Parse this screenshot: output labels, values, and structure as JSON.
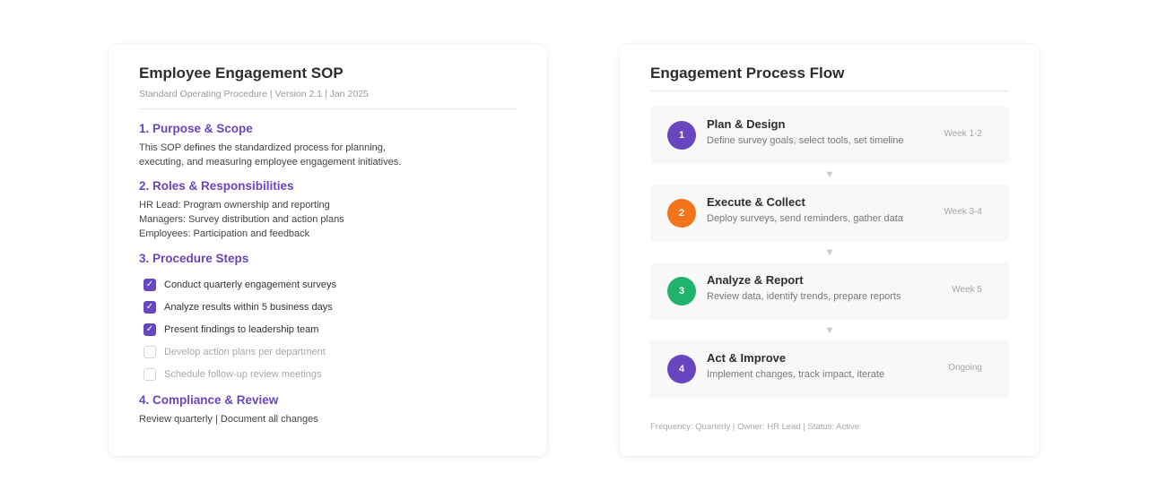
{
  "sop": {
    "title": "Employee Engagement SOP",
    "subtitle": "Standard Operating Procedure | Version 2.1 | Jan 2025",
    "sections": {
      "purpose": {
        "title": "1. Purpose & Scope",
        "lines": [
          "This SOP defines the standardized process for planning,",
          "executing, and measuring employee engagement initiatives."
        ]
      },
      "roles": {
        "title": "2. Roles & Responsibilities",
        "lines": [
          "HR Lead: Program ownership and reporting",
          "Managers: Survey distribution and action plans",
          "Employees: Participation and feedback"
        ]
      },
      "steps": {
        "title": "3. Procedure Steps",
        "items": [
          {
            "label": "Conduct quarterly engagement surveys",
            "checked": true
          },
          {
            "label": "Analyze results within 5 business days",
            "checked": true
          },
          {
            "label": "Present findings to leadership team",
            "checked": true
          },
          {
            "label": "Develop action plans per department",
            "checked": false
          },
          {
            "label": "Schedule follow-up review meetings",
            "checked": false
          }
        ]
      },
      "compliance": {
        "title": "4. Compliance & Review",
        "text": "Review quarterly | Document all changes"
      }
    },
    "check_glyph": "✓",
    "accent_color": "#6a45c0"
  },
  "flow": {
    "title": "Engagement Process Flow",
    "steps": [
      {
        "number": "1",
        "name": "Plan & Design",
        "description": "Define survey goals, select tools, set timeline",
        "timing": "Week 1-2",
        "color": "#6a45c0"
      },
      {
        "number": "2",
        "name": "Execute & Collect",
        "description": "Deploy surveys, send reminders, gather data",
        "timing": "Week 3-4",
        "color": "#f4741c"
      },
      {
        "number": "3",
        "name": "Analyze & Report",
        "description": "Review data, identify trends, prepare reports",
        "timing": "Week 5",
        "color": "#21b36b"
      },
      {
        "number": "4",
        "name": "Act & Improve",
        "description": "Implement changes, track impact, iterate",
        "timing": "Ongoing",
        "color": "#6a45c0"
      }
    ],
    "arrow_glyph": "▼",
    "footer": "Frequency: Quarterly | Owner: HR Lead | Status: Active"
  }
}
